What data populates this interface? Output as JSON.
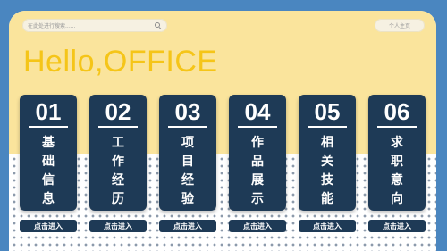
{
  "search": {
    "placeholder": "在此处进行搜索......"
  },
  "header": {
    "profile_label": "个人主页"
  },
  "hero": {
    "title": "Hello,OFFICE"
  },
  "cards": [
    {
      "number": "01",
      "chars": [
        "基",
        "础",
        "信",
        "息"
      ],
      "button": "点击进入"
    },
    {
      "number": "02",
      "chars": [
        "工",
        "作",
        "经",
        "历"
      ],
      "button": "点击进入"
    },
    {
      "number": "03",
      "chars": [
        "项",
        "目",
        "经",
        "验"
      ],
      "button": "点击进入"
    },
    {
      "number": "04",
      "chars": [
        "作",
        "品",
        "展",
        "示"
      ],
      "button": "点击进入"
    },
    {
      "number": "05",
      "chars": [
        "相",
        "关",
        "技",
        "能"
      ],
      "button": "点击进入"
    },
    {
      "number": "06",
      "chars": [
        "求",
        "职",
        "意",
        "向"
      ],
      "button": "点击进入"
    }
  ],
  "colors": {
    "background_blue": "#4a86c0",
    "header_yellow": "#fae49c",
    "card_navy": "#1e3a56",
    "title_yellow": "#f5c518"
  }
}
